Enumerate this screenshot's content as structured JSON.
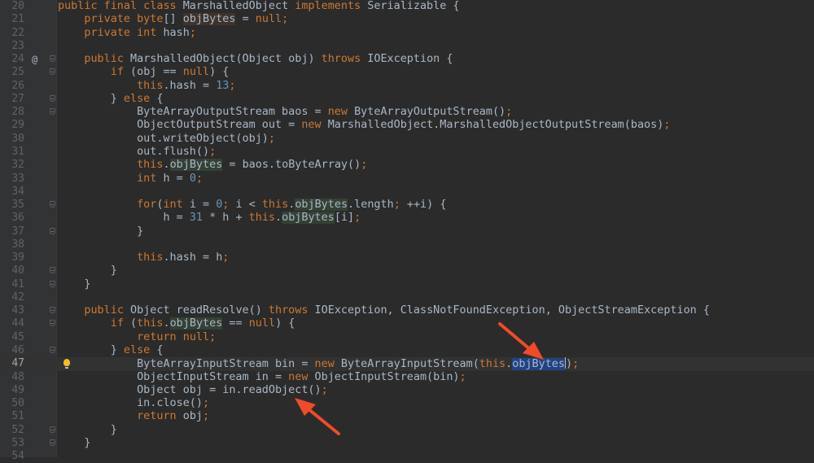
{
  "editor": {
    "current_line": 47,
    "colors": {
      "background": "#2b2b2b",
      "keyword": "#cc7832",
      "number": "#6897bb",
      "text": "#a9b7c6",
      "selection": "#214283",
      "arrow": "#f04a2a"
    },
    "gutter_marks": {
      "24": "@"
    },
    "intention_bulb_line": 47,
    "fold_lines": [
      24,
      25,
      27,
      28,
      35,
      37,
      40,
      41,
      43,
      44,
      46,
      52,
      53
    ],
    "lines": [
      {
        "n": "20",
        "tokens": [
          [
            "public final class",
            "k"
          ],
          [
            " MarshalledObject ",
            "t"
          ],
          [
            "implements",
            "k"
          ],
          [
            " Serializable {",
            "t"
          ]
        ]
      },
      {
        "n": "21",
        "tokens": [
          [
            "    ",
            "t"
          ],
          [
            "private byte",
            "k"
          ],
          [
            "[] ",
            "t"
          ],
          [
            "objBytes",
            "d"
          ],
          [
            " = ",
            "t"
          ],
          [
            "null",
            "k"
          ],
          [
            ";",
            "k"
          ]
        ]
      },
      {
        "n": "22",
        "tokens": [
          [
            "    ",
            "t"
          ],
          [
            "private int",
            "k"
          ],
          [
            " hash",
            "t"
          ],
          [
            ";",
            "k"
          ]
        ]
      },
      {
        "n": "23",
        "tokens": []
      },
      {
        "n": "24",
        "tokens": [
          [
            "    ",
            "t"
          ],
          [
            "public",
            "k"
          ],
          [
            " MarshalledObject(Object obj) ",
            "t"
          ],
          [
            "throws",
            "k"
          ],
          [
            " IOException {",
            "t"
          ]
        ]
      },
      {
        "n": "25",
        "tokens": [
          [
            "        ",
            "t"
          ],
          [
            "if",
            "k"
          ],
          [
            " (obj == ",
            "t"
          ],
          [
            "null",
            "k"
          ],
          [
            ") {",
            "t"
          ]
        ]
      },
      {
        "n": "26",
        "tokens": [
          [
            "            ",
            "t"
          ],
          [
            "this",
            "k"
          ],
          [
            ".hash = ",
            "t"
          ],
          [
            "13",
            "n"
          ],
          [
            ";",
            "k"
          ]
        ]
      },
      {
        "n": "27",
        "tokens": [
          [
            "        } ",
            "t"
          ],
          [
            "else",
            "k"
          ],
          [
            " {",
            "t"
          ]
        ]
      },
      {
        "n": "28",
        "tokens": [
          [
            "            ByteArrayOutputStream baos = ",
            "t"
          ],
          [
            "new",
            "k"
          ],
          [
            " ByteArrayOutputStream()",
            "t"
          ],
          [
            ";",
            "k"
          ]
        ]
      },
      {
        "n": "29",
        "tokens": [
          [
            "            ObjectOutputStream out = ",
            "t"
          ],
          [
            "new",
            "k"
          ],
          [
            " MarshalledObject.MarshalledObjectOutputStream(baos)",
            "t"
          ],
          [
            ";",
            "k"
          ]
        ]
      },
      {
        "n": "30",
        "tokens": [
          [
            "            out.writeObject(obj)",
            "t"
          ],
          [
            ";",
            "k"
          ]
        ]
      },
      {
        "n": "31",
        "tokens": [
          [
            "            out.flush()",
            "t"
          ],
          [
            ";",
            "k"
          ]
        ]
      },
      {
        "n": "32",
        "tokens": [
          [
            "            ",
            "t"
          ],
          [
            "this",
            "k"
          ],
          [
            ".",
            "t"
          ],
          [
            "objBytes",
            "h"
          ],
          [
            " = baos.toByteArray()",
            "t"
          ],
          [
            ";",
            "k"
          ]
        ]
      },
      {
        "n": "33",
        "tokens": [
          [
            "            ",
            "t"
          ],
          [
            "int",
            "k"
          ],
          [
            " h = ",
            "t"
          ],
          [
            "0",
            "n"
          ],
          [
            ";",
            "k"
          ]
        ]
      },
      {
        "n": "34",
        "tokens": []
      },
      {
        "n": "35",
        "tokens": [
          [
            "            ",
            "t"
          ],
          [
            "for",
            "k"
          ],
          [
            "(",
            "t"
          ],
          [
            "int",
            "k"
          ],
          [
            " i = ",
            "t"
          ],
          [
            "0",
            "n"
          ],
          [
            ";",
            "k"
          ],
          [
            " i < ",
            "t"
          ],
          [
            "this",
            "k"
          ],
          [
            ".",
            "t"
          ],
          [
            "objBytes",
            "h"
          ],
          [
            ".length",
            "t"
          ],
          [
            ";",
            "k"
          ],
          [
            " ++i) {",
            "t"
          ]
        ]
      },
      {
        "n": "36",
        "tokens": [
          [
            "                h = ",
            "t"
          ],
          [
            "31",
            "n"
          ],
          [
            " * h + ",
            "t"
          ],
          [
            "this",
            "k"
          ],
          [
            ".",
            "t"
          ],
          [
            "objBytes",
            "h"
          ],
          [
            "[i]",
            "t"
          ],
          [
            ";",
            "k"
          ]
        ]
      },
      {
        "n": "37",
        "tokens": [
          [
            "            }",
            "t"
          ]
        ]
      },
      {
        "n": "38",
        "tokens": []
      },
      {
        "n": "39",
        "tokens": [
          [
            "            ",
            "t"
          ],
          [
            "this",
            "k"
          ],
          [
            ".hash = h",
            "t"
          ],
          [
            ";",
            "k"
          ]
        ]
      },
      {
        "n": "40",
        "tokens": [
          [
            "        }",
            "t"
          ]
        ]
      },
      {
        "n": "41",
        "tokens": [
          [
            "    }",
            "t"
          ]
        ]
      },
      {
        "n": "42",
        "tokens": []
      },
      {
        "n": "43",
        "tokens": [
          [
            "    ",
            "t"
          ],
          [
            "public",
            "k"
          ],
          [
            " Object readResolve() ",
            "t"
          ],
          [
            "throws",
            "k"
          ],
          [
            " IOException, ClassNotFoundException, ObjectStreamException {",
            "t"
          ]
        ]
      },
      {
        "n": "44",
        "tokens": [
          [
            "        ",
            "t"
          ],
          [
            "if",
            "k"
          ],
          [
            " (",
            "t"
          ],
          [
            "this",
            "k"
          ],
          [
            ".",
            "t"
          ],
          [
            "objBytes",
            "h"
          ],
          [
            " == ",
            "t"
          ],
          [
            "null",
            "k"
          ],
          [
            ") {",
            "t"
          ]
        ]
      },
      {
        "n": "45",
        "tokens": [
          [
            "            ",
            "t"
          ],
          [
            "return null",
            "k"
          ],
          [
            ";",
            "k"
          ]
        ]
      },
      {
        "n": "46",
        "tokens": [
          [
            "        } ",
            "t"
          ],
          [
            "else",
            "k"
          ],
          [
            " {",
            "t"
          ]
        ]
      },
      {
        "n": "47",
        "tokens": [
          [
            "            ByteArrayInputStream bin = ",
            "t"
          ],
          [
            "new",
            "k"
          ],
          [
            " ByteArrayInputStream(",
            "t"
          ],
          [
            "this",
            "k"
          ],
          [
            ".",
            "t"
          ],
          [
            "objBytes",
            "s"
          ],
          [
            "|",
            "caret"
          ],
          [
            ")",
            "t"
          ],
          [
            ";",
            "k"
          ]
        ]
      },
      {
        "n": "48",
        "tokens": [
          [
            "            ObjectInputStream in = ",
            "t"
          ],
          [
            "new",
            "k"
          ],
          [
            " ObjectInputStream(bin)",
            "t"
          ],
          [
            ";",
            "k"
          ]
        ]
      },
      {
        "n": "49",
        "tokens": [
          [
            "            Object obj = in.readObject()",
            "t"
          ],
          [
            ";",
            "k"
          ]
        ]
      },
      {
        "n": "50",
        "tokens": [
          [
            "            in.close()",
            "t"
          ],
          [
            ";",
            "k"
          ]
        ]
      },
      {
        "n": "51",
        "tokens": [
          [
            "            ",
            "t"
          ],
          [
            "return",
            "k"
          ],
          [
            " obj",
            "t"
          ],
          [
            ";",
            "k"
          ]
        ]
      },
      {
        "n": "52",
        "tokens": [
          [
            "        }",
            "t"
          ]
        ]
      },
      {
        "n": "53",
        "tokens": [
          [
            "    }",
            "t"
          ]
        ]
      },
      {
        "n": "54",
        "tokens": []
      }
    ]
  }
}
